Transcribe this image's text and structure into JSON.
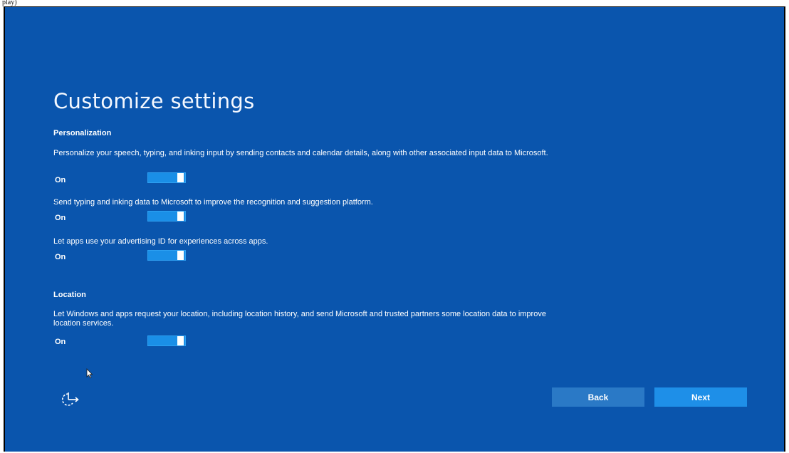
{
  "corner_text": "play)",
  "page": {
    "title": "Customize settings"
  },
  "personalization": {
    "title": "Personalization",
    "items": [
      {
        "description": "Personalize your speech, typing, and inking input by sending contacts and calendar details, along with other associated input data to Microsoft.",
        "state_label": "On",
        "enabled": true
      },
      {
        "description": "Send typing and inking data to Microsoft to improve the recognition and suggestion platform.",
        "state_label": "On",
        "enabled": true
      },
      {
        "description": "Let apps use your advertising ID for experiences across apps.",
        "state_label": "On",
        "enabled": true
      }
    ]
  },
  "location": {
    "title": "Location",
    "items": [
      {
        "description": "Let Windows and apps request your location, including location history, and send Microsoft and trusted partners some location data to improve location services.",
        "state_label": "On",
        "enabled": true
      }
    ]
  },
  "footer": {
    "back_label": "Back",
    "next_label": "Next",
    "accessibility_icon": "ease-of-access-icon",
    "cursor_icon": "mouse-pointer-icon"
  },
  "colors": {
    "background": "#0a55ad",
    "toggle_on": "#1a8fe7",
    "back_button": "#2a79c6",
    "next_button": "#1e8fe8"
  }
}
